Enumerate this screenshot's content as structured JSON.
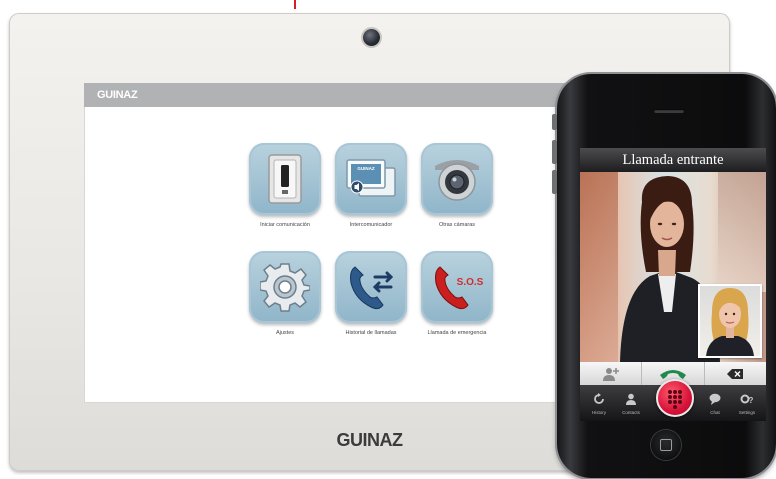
{
  "tablet": {
    "header_brand": "GUINAZ",
    "bezel_brand": "GUINAZ",
    "apps": [
      {
        "label": "Iniciar comunicación",
        "icon": "door-panel-icon"
      },
      {
        "label": "Intercomunicador",
        "icon": "intercom-screens-icon"
      },
      {
        "label": "Otras cámaras",
        "icon": "security-camera-icon"
      },
      {
        "label": "Ajustes",
        "icon": "gear-icon"
      },
      {
        "label": "Historial de llamadas",
        "icon": "call-history-icon"
      },
      {
        "label": "Llamada de emergencia",
        "icon": "sos-phone-icon"
      }
    ],
    "intercom_screen_text": "GUINAZ",
    "sos_text": "S.O.S"
  },
  "phone": {
    "call_title": "Llamada entrante",
    "actions": [
      "add-contact-icon",
      "answer-call-icon",
      "backspace-icon"
    ],
    "tabs": [
      {
        "label": "History",
        "icon": "history-icon"
      },
      {
        "label": "Contacts",
        "icon": "contacts-icon"
      },
      {
        "label": "",
        "icon": "keypad-icon"
      },
      {
        "label": "Chat",
        "icon": "chat-icon"
      },
      {
        "label": "Settings",
        "icon": "settings-icon"
      }
    ]
  },
  "colors": {
    "tile": "#9ec0d2",
    "header_bar": "#b1b2b4",
    "answer_green": "#1f8a4c",
    "dial_red": "#d8133a",
    "sos_red": "#d42b2b"
  }
}
